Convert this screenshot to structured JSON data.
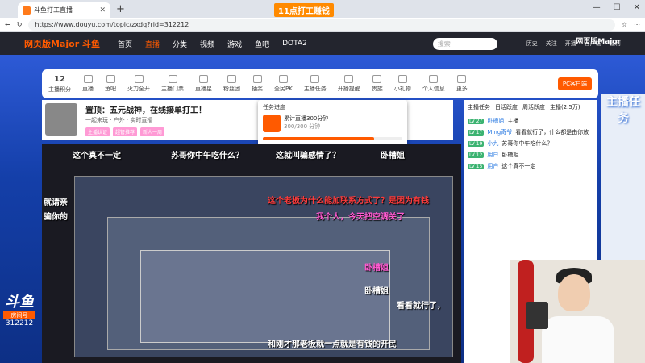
{
  "browser": {
    "tab_title": "斗鱼打工直播",
    "url": "https://www.douyu.com/topic/zxdq?rid=312212",
    "banner": "11点打工赚钱"
  },
  "site": {
    "logo": "网页版Major 斗鱼",
    "nav": [
      "首页",
      "直播",
      "分类",
      "视频",
      "游戏",
      "鱼吧",
      "DOTA2"
    ],
    "search_placeholder": "搜索",
    "header_icons": [
      "历史",
      "关注",
      "开播",
      "客户端",
      "福利"
    ],
    "right_logo": "网页版Major"
  },
  "categories": {
    "count": "12",
    "count_label": "主播积分",
    "items": [
      "直播",
      "鱼吧",
      "火力全开",
      "主播门票",
      "直播星",
      "粉丝团",
      "抽奖",
      "全民PK",
      "主播任务",
      "开播提醒",
      "贵族",
      "小礼物",
      "个人信息",
      "更多"
    ],
    "pc_button": "PC客户端"
  },
  "streamer": {
    "title": "置顶：五元战神，在线接单打工！",
    "name": "卧槽姐",
    "meta": "一起来玩 · 户外 · 实时直播",
    "badges": [
      "主播认证",
      "超管推荐",
      "新人一周"
    ]
  },
  "popup": {
    "title": "任务进度",
    "task": "累计直播300分钟",
    "sub": "300/300 分钟"
  },
  "danmu": [
    {
      "text": "这个真不一定",
      "color": "#ffffff"
    },
    {
      "text": "苏哥你中午吃什么？",
      "color": "#ffffff"
    },
    {
      "text": "这就叫骗感情了？",
      "color": "#ffffff"
    },
    {
      "text": "卧槽姐",
      "color": "#ffffff"
    },
    {
      "text": "这个老板为什么能加联系方式了？是因为有钱",
      "color": "#ff3b3b"
    },
    {
      "text": "我个人，今天把空调关了",
      "color": "#ff5ad0"
    },
    {
      "text": "卧槽姐",
      "color": "#ff5ad0"
    },
    {
      "text": "看看就行了，",
      "color": "#ffffff"
    },
    {
      "text": "和刚才那老板就一点就是有钱的开民",
      "color": "#ffffff"
    },
    {
      "text": "骗你的",
      "color": "#ffffff"
    },
    {
      "text": "就请亲",
      "color": "#ffffff"
    },
    {
      "text": "卧槽姐",
      "color": "#ffffff"
    }
  ],
  "chat": {
    "tabs": [
      "主播任务",
      "日活跃度",
      "周活跃度",
      "主播(2.5万)"
    ],
    "rows": [
      {
        "lv": "LV 27",
        "name": "卧槽姐",
        "text": "主播"
      },
      {
        "lv": "LV 17",
        "name": "Ming奇爷",
        "text": "看看就行了，什么都是由你放"
      },
      {
        "lv": "LV 19",
        "name": "小九",
        "text": "苏哥你中午吃什么？"
      },
      {
        "lv": "LV 12",
        "name": "用户",
        "text": "卧槽姐"
      },
      {
        "lv": "LV 15",
        "name": "用户",
        "text": "这个真不一定"
      }
    ]
  },
  "room": {
    "logo": "斗鱼",
    "label": "房间号",
    "number": "312212"
  },
  "rank": {
    "mascot": "主播任务"
  }
}
